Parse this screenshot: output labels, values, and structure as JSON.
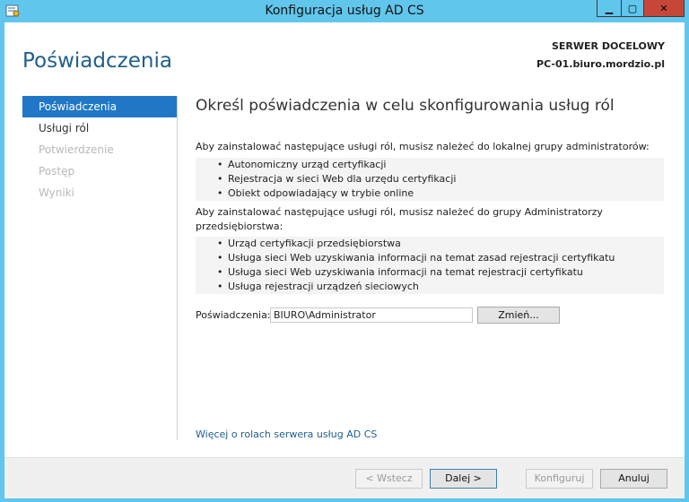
{
  "window": {
    "title": "Konfiguracja usług AD CS",
    "min_symbol": "▁",
    "max_symbol": "▢",
    "close_symbol": "✕"
  },
  "header": {
    "page_title": "Poświadczenia",
    "server_label": "SERWER DOCELOWY",
    "server_name": "PC-01.biuro.mordzio.pl"
  },
  "nav": {
    "items": [
      {
        "label": "Poświadczenia"
      },
      {
        "label": "Usługi ról"
      },
      {
        "label": "Potwierdzenie"
      },
      {
        "label": "Postęp"
      },
      {
        "label": "Wyniki"
      }
    ]
  },
  "main": {
    "heading": "Określ poświadczenia w celu skonfigurowania usług ról",
    "para1": "Aby zainstalować następujące usługi ról, musisz należeć do lokalnej grupy administratorów:",
    "list1": [
      "Autonomiczny urząd certyfikacji",
      "Rejestracja w sieci Web dla urzędu certyfikacji",
      "Obiekt odpowiadający w trybie online"
    ],
    "para2_line1": "Aby zainstalować następujące usługi ról, musisz należeć do grupy Administratorzy",
    "para2_line2": "przedsiębiorstwa:",
    "list2": [
      "Urząd certyfikacji przedsiębiorstwa",
      "Usługa sieci Web uzyskiwania informacji na temat zasad rejestracji certyfikatu",
      "Usługa sieci Web uzyskiwania informacji na temat rejestracji certyfikatu",
      "Usługa rejestracji urządzeń sieciowych"
    ],
    "cred_label": "Poświadczenia:",
    "cred_value": "BIURO\\Administrator",
    "change_button": "Zmień...",
    "more_link": "Więcej o rolach serwera usług AD CS"
  },
  "footer": {
    "back": "< Wstecz",
    "next": "Dalej >",
    "configure": "Konfiguruj",
    "cancel": "Anuluj"
  },
  "colors": {
    "title_bar": "#61c6ec",
    "nav_active": "#1f77c6",
    "accent_text": "#1f5f8b",
    "close_button": "#c7463a"
  }
}
